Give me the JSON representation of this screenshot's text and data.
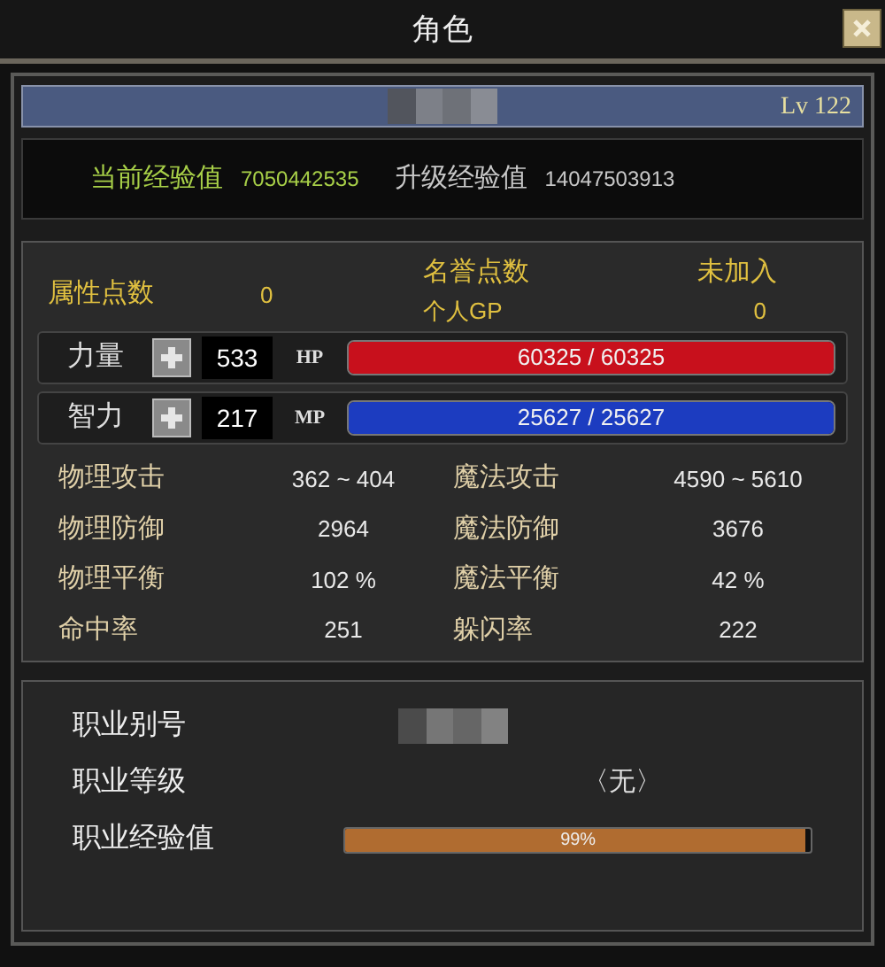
{
  "window": {
    "title": "角色"
  },
  "character": {
    "level": "Lv 122",
    "name_hidden": true
  },
  "experience": [
    {
      "label": "当前经验值",
      "value": "7050442535",
      "kind": "current"
    },
    {
      "label": "升级经验值",
      "value": "14047503913",
      "kind": "next"
    }
  ],
  "points": {
    "label": "属性点数",
    "value": "0"
  },
  "honor": {
    "label": "名誉点数",
    "value": "未加入"
  },
  "gp": {
    "label": "个人GP",
    "value": "0"
  },
  "attributes": [
    {
      "label": "力量",
      "value": "533",
      "bar_label": "HP",
      "reading": "60325 / 60325",
      "level": 1,
      "color": "#c8101c"
    },
    {
      "label": "智力",
      "value": "217",
      "bar_label": "MP",
      "reading": "25627 / 25627",
      "level": 1,
      "color": "#1c3cc0"
    }
  ],
  "stats": [
    {
      "label": "物理攻击",
      "value": "362 ~ 404"
    },
    {
      "label": "魔法攻击",
      "value": "4590 ~ 5610"
    },
    {
      "label": "物理防御",
      "value": "2964"
    },
    {
      "label": "魔法防御",
      "value": "3676"
    },
    {
      "label": "物理平衡",
      "value": "102 %"
    },
    {
      "label": "魔法平衡",
      "value": "42 %"
    },
    {
      "label": "命中率",
      "value": "251"
    },
    {
      "label": "躲闪率",
      "value": "222"
    }
  ],
  "job": [
    {
      "label": "职业别号",
      "kind": "hidden"
    },
    {
      "label": "职业等级",
      "kind": "text",
      "value": "〈无〉"
    },
    {
      "label": "职业经验值",
      "kind": "bar",
      "level": 0.99,
      "reading": "99%"
    }
  ]
}
